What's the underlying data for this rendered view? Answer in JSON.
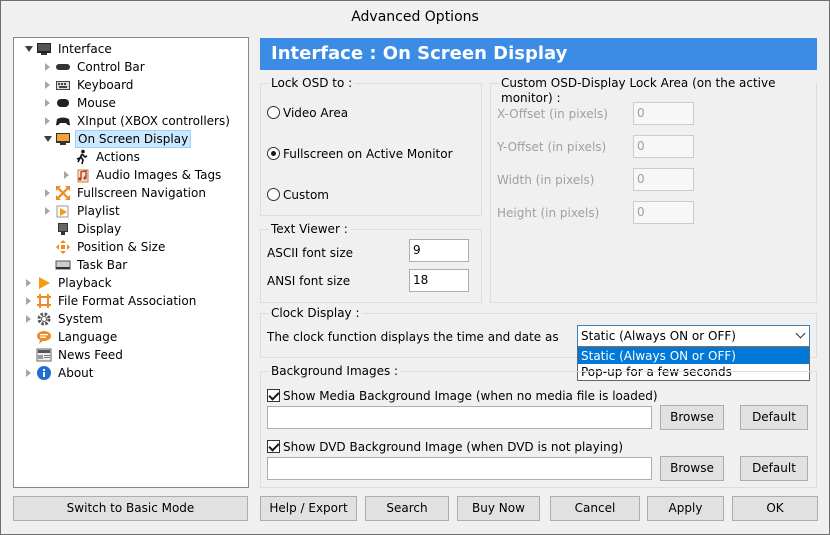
{
  "window": {
    "title": "Advanced Options"
  },
  "tree": [
    {
      "label": "Interface",
      "expander": "open",
      "icon": "monitor-icon"
    },
    {
      "label": "Control Bar",
      "expander": "closed",
      "icon": "control-bar-icon"
    },
    {
      "label": "Keyboard",
      "expander": "closed",
      "icon": "keyboard-icon"
    },
    {
      "label": "Mouse",
      "expander": "closed",
      "icon": "mouse-icon"
    },
    {
      "label": "XInput (XBOX controllers)",
      "expander": "closed",
      "icon": "gamepad-icon"
    },
    {
      "label": "On Screen Display",
      "expander": "open",
      "icon": "osd-icon",
      "selected": true
    },
    {
      "label": "Actions",
      "expander": "none",
      "icon": "running-man-icon"
    },
    {
      "label": "Audio Images & Tags",
      "expander": "closed",
      "icon": "music-note-icon"
    },
    {
      "label": "Fullscreen Navigation",
      "expander": "closed",
      "icon": "fullscreen-arrows-icon"
    },
    {
      "label": "Playlist",
      "expander": "closed",
      "icon": "playlist-icon"
    },
    {
      "label": "Display",
      "expander": "none",
      "icon": "display-icon"
    },
    {
      "label": "Position & Size",
      "expander": "none",
      "icon": "position-size-icon"
    },
    {
      "label": "Task Bar",
      "expander": "none",
      "icon": "task-bar-icon"
    },
    {
      "label": "Playback",
      "expander": "closed",
      "icon": "play-icon"
    },
    {
      "label": "File Format Association",
      "expander": "closed",
      "icon": "file-association-icon"
    },
    {
      "label": "System",
      "expander": "closed",
      "icon": "gear-icon"
    },
    {
      "label": "Language",
      "expander": "none",
      "icon": "speech-bubble-icon"
    },
    {
      "label": "News Feed",
      "expander": "none",
      "icon": "news-icon"
    },
    {
      "label": "About",
      "expander": "closed",
      "icon": "info-icon"
    }
  ],
  "header": {
    "title": "Interface : On Screen Display"
  },
  "lock_osd": {
    "title": "Lock OSD to :",
    "options": [
      "Video Area",
      "Fullscreen on Active Monitor",
      "Custom"
    ],
    "selected_index": 1
  },
  "custom_area": {
    "title": "Custom OSD-Display Lock Area (on the active monitor) :",
    "fields": [
      {
        "label": "X-Offset (in pixels)",
        "value": "0"
      },
      {
        "label": "Y-Offset (in pixels)",
        "value": "0"
      },
      {
        "label": "Width (in pixels)",
        "value": "0"
      },
      {
        "label": "Height (in pixels)",
        "value": "0"
      }
    ]
  },
  "text_viewer": {
    "title": "Text Viewer :",
    "ascii_label": "ASCII font size",
    "ascii_value": "9",
    "ansi_label": "ANSI font size",
    "ansi_value": "18"
  },
  "clock": {
    "title": "Clock Display :",
    "label": "The clock function displays the time and date as",
    "selected": "Static (Always ON or OFF)",
    "options": [
      "Static (Always ON or OFF)",
      "Pop-up for a few seconds"
    ]
  },
  "background": {
    "title": "Background Images :",
    "media_label": "Show Media Background Image (when no media file is loaded)",
    "media_checked": true,
    "media_path": "",
    "dvd_label": "Show DVD Background Image (when DVD is not playing)",
    "dvd_checked": true,
    "dvd_path": "",
    "browse_label": "Browse",
    "default_label": "Default"
  },
  "footer": {
    "basic_mode": "Switch to Basic Mode",
    "help_export": "Help / Export",
    "search": "Search",
    "buy_now": "Buy Now",
    "cancel": "Cancel",
    "apply": "Apply",
    "ok": "OK"
  }
}
